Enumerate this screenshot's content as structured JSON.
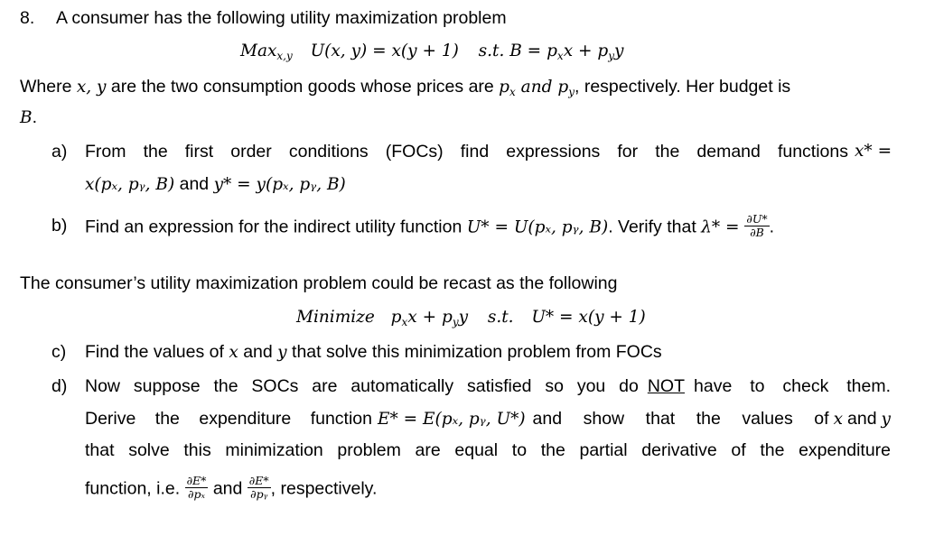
{
  "question": {
    "number": "8.",
    "intro": "A consumer has the following utility maximization problem",
    "max_problem": {
      "max_label": "Max",
      "max_sub": "x,y",
      "objective": "U(x, y) = x(y + 1)",
      "constraint_prefix": "s.t. B = ",
      "constraint_terms": [
        "p",
        "x",
        "x + ",
        "p",
        "y",
        "y"
      ]
    },
    "where_text": {
      "part1": "Where ",
      "vars": "x, y",
      "part2": " are the two consumption goods whose prices are ",
      "px": "p",
      "px_sub": "x",
      "and_word": " and ",
      "py": "p",
      "py_sub": "y",
      "part3": ", respectively. Her budget is",
      "budget_var": "B",
      "period": "."
    },
    "parts": [
      {
        "label": "a)",
        "line1": "From the first order conditions (FOCs) find expressions for the demand functions",
        "line1_math": "x* =",
        "line2_math1": "x(pₓ, pᵧ, B)",
        "line2_and": " and ",
        "line2_math2": "y* = y(pₓ, pᵧ, B)"
      },
      {
        "label": "b)",
        "text1": "Find an expression for the indirect utility function ",
        "math1": "U* = U(pₓ, pᵧ, B)",
        "text2": ". Verify that ",
        "math2": "λ* = ",
        "frac_num": "∂U*",
        "frac_den": "∂B",
        "end": "."
      }
    ],
    "recast_text": "The consumer’s utility maximization problem could be recast as the following",
    "min_problem": {
      "min_label": "Minimize",
      "objective": "pₓx + pᵧy",
      "st": "s.t.",
      "constraint": "U* = x(y + 1)"
    },
    "parts2": [
      {
        "label": "c)",
        "text1": "Find the values of ",
        "x": "x",
        "and": " and ",
        "y": "y",
        "text2": " that solve this minimization problem from FOCs"
      },
      {
        "label": "d)",
        "line1_a": "Now suppose the SOCs are automatically satisfied so you do",
        "line1_not": "NOT",
        "line1_b": "have to check them.",
        "line2_a": "Derive the expenditure function",
        "line2_math": "E* = E(pₓ, pᵧ, U*)",
        "line2_b": "and show that the values of",
        "line2_x": "x",
        "line2_and": "and",
        "line2_y": "y",
        "line3": "that solve this minimization problem are equal to the partial derivative of the expenditure",
        "line4_a": "function, i.e. ",
        "frac1_num": "∂E*",
        "frac1_den": "∂pₓ",
        "line4_and": " and ",
        "frac2_num": "∂E*",
        "frac2_den": "∂pᵧ",
        "line4_b": ", respectively."
      }
    ]
  }
}
